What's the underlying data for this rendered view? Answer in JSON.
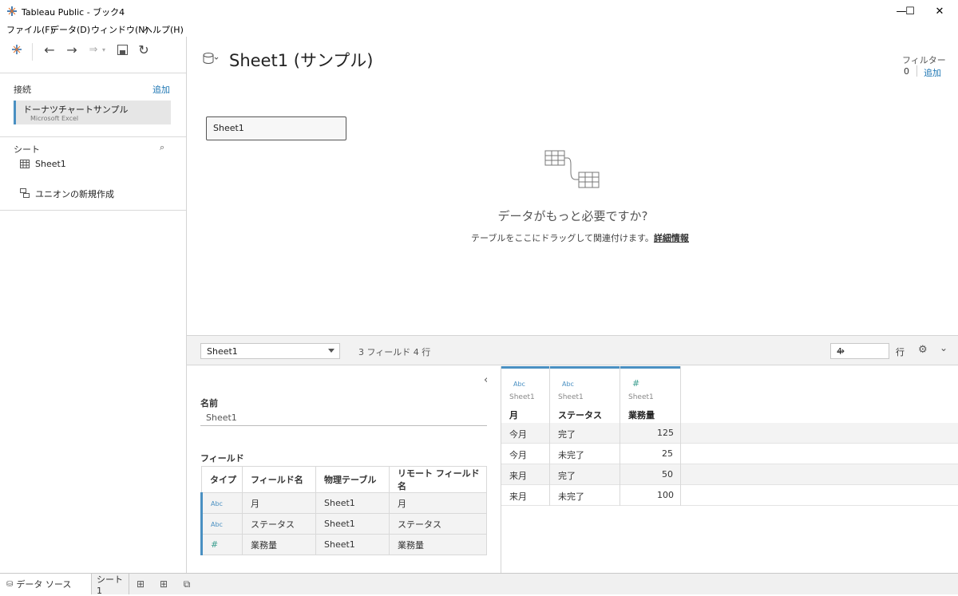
{
  "window": {
    "title": "Tableau Public - ブック4",
    "minimize": "—",
    "maximize": "☐",
    "close": "✕"
  },
  "menu": [
    "ファイル(F)",
    "データ(D)",
    "ウィンドウ(N)",
    "ヘルプ(H)"
  ],
  "left": {
    "connections_label": "接続",
    "add_label": "追加",
    "connection": {
      "name": "ドーナツチャートサンプル",
      "type": "Microsoft Excel"
    },
    "sheets_label": "シート",
    "sheets": [
      "Sheet1"
    ],
    "new_union": "ユニオンの新規作成"
  },
  "canvas": {
    "title": "Sheet1 (サンプル)",
    "filter_label": "フィルター",
    "filter_count": "0",
    "filter_add": "追加",
    "sheet_box": "Sheet1",
    "need_title": "データがもっと必要ですか?",
    "need_sub": "テーブルをここにドラッグして関連付けます。",
    "need_link": "詳細情報"
  },
  "gridbar": {
    "table_select": "Sheet1",
    "field_count": "3 フィールド 4 行",
    "rows_value": "4",
    "rows_label": "行"
  },
  "meta": {
    "name_label": "名前",
    "name_value": "Sheet1",
    "fields_label": "フィールド",
    "headers": [
      "タイプ",
      "フィールド名",
      "物理テーブル",
      "リモート フィールド名"
    ],
    "rows": [
      {
        "type": "Abc",
        "name": "月",
        "table": "Sheet1",
        "remote": "月"
      },
      {
        "type": "Abc",
        "name": "ステータス",
        "table": "Sheet1",
        "remote": "ステータス"
      },
      {
        "type": "#",
        "name": "業務量",
        "table": "Sheet1",
        "remote": "業務量"
      }
    ]
  },
  "data": {
    "columns": [
      {
        "type": "Abc",
        "table": "Sheet1",
        "name": "月"
      },
      {
        "type": "Abc",
        "table": "Sheet1",
        "name": "ステータス"
      },
      {
        "type": "#",
        "table": "Sheet1",
        "name": "業務量"
      }
    ],
    "rows": [
      [
        "今月",
        "完了",
        "125"
      ],
      [
        "今月",
        "未完了",
        "25"
      ],
      [
        "来月",
        "完了",
        "50"
      ],
      [
        "来月",
        "未完了",
        "100"
      ]
    ]
  },
  "footer": {
    "datasource_tab": "データ ソース",
    "sheet_tab": "シート 1"
  },
  "colors": {
    "accent": "#4a90c2",
    "link": "#1f77b4",
    "numeric": "#3b9e8f"
  }
}
